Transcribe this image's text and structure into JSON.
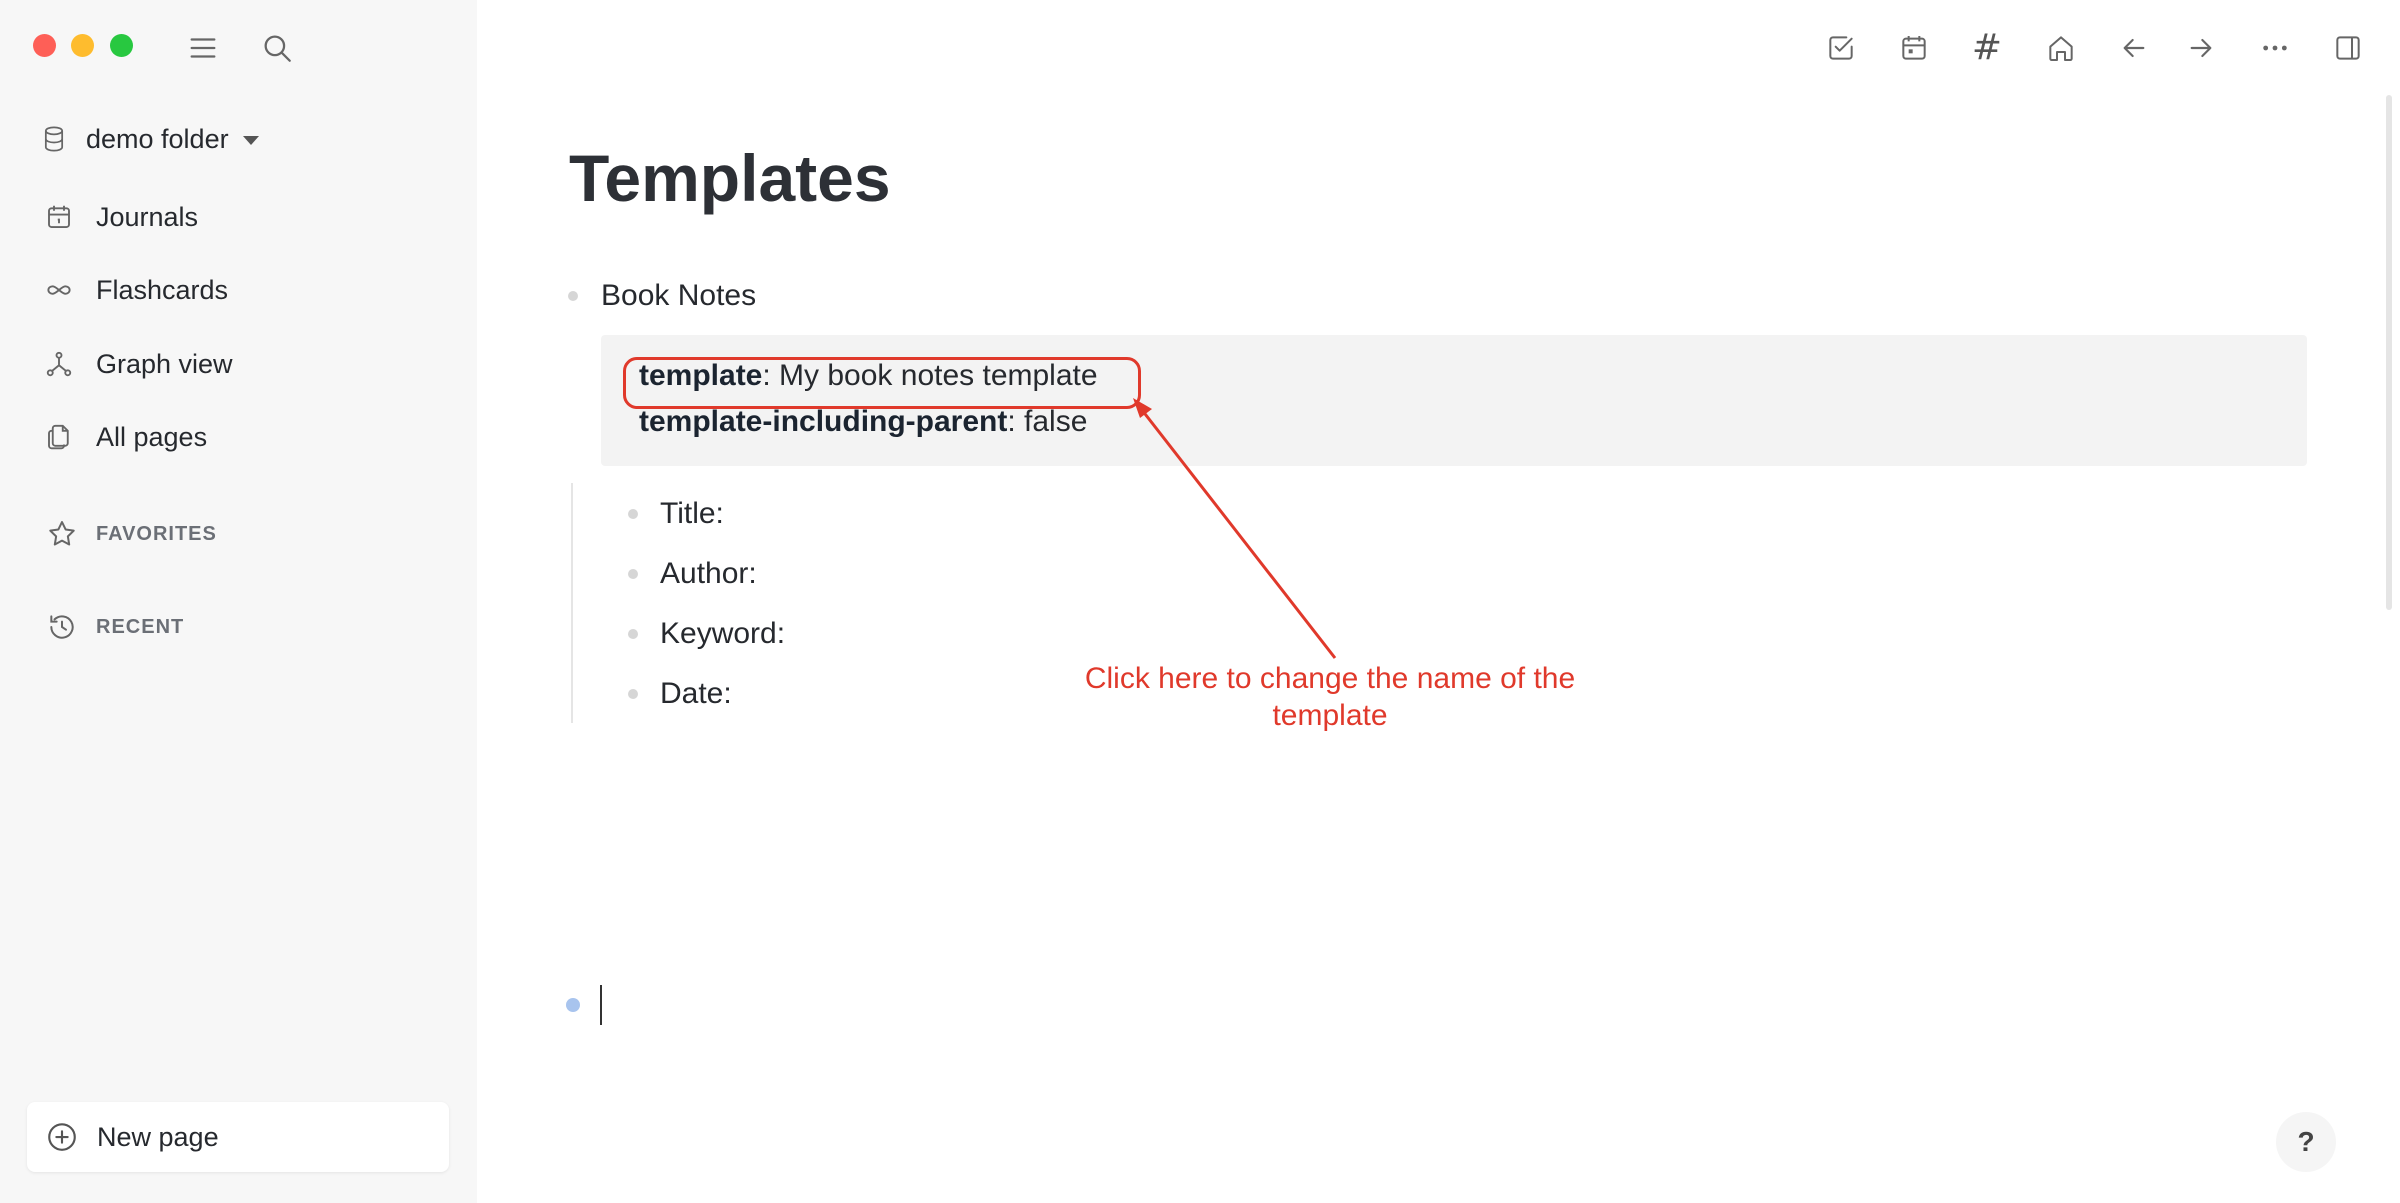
{
  "sidebar": {
    "graph_name": "demo folder",
    "nav": [
      {
        "label": "Journals",
        "icon": "calendar-icon"
      },
      {
        "label": "Flashcards",
        "icon": "infinity-icon"
      },
      {
        "label": "Graph view",
        "icon": "graph-icon"
      },
      {
        "label": "All pages",
        "icon": "pages-icon"
      }
    ],
    "favorites_label": "FAVORITES",
    "recent_label": "RECENT",
    "new_page_label": "New page"
  },
  "header": {
    "icons": [
      "checkbox-icon",
      "calendar-icon",
      "hash-icon",
      "home-icon",
      "arrow-left-icon",
      "arrow-right-icon",
      "more-icon",
      "sidebar-toggle-icon"
    ],
    "hash_glyph": "#"
  },
  "page": {
    "title": "Templates",
    "block_title": "Book Notes",
    "properties": [
      {
        "key": "template",
        "value": "My book notes template"
      },
      {
        "key": "template-including-parent",
        "value": "false"
      }
    ],
    "separator": ": ",
    "children": [
      "Title:",
      "Author:",
      "Keyword:",
      "Date:"
    ]
  },
  "annotation": {
    "line1": "Click here to change the name of the",
    "line2": "template",
    "color": "#e0392b"
  },
  "help_label": "?"
}
